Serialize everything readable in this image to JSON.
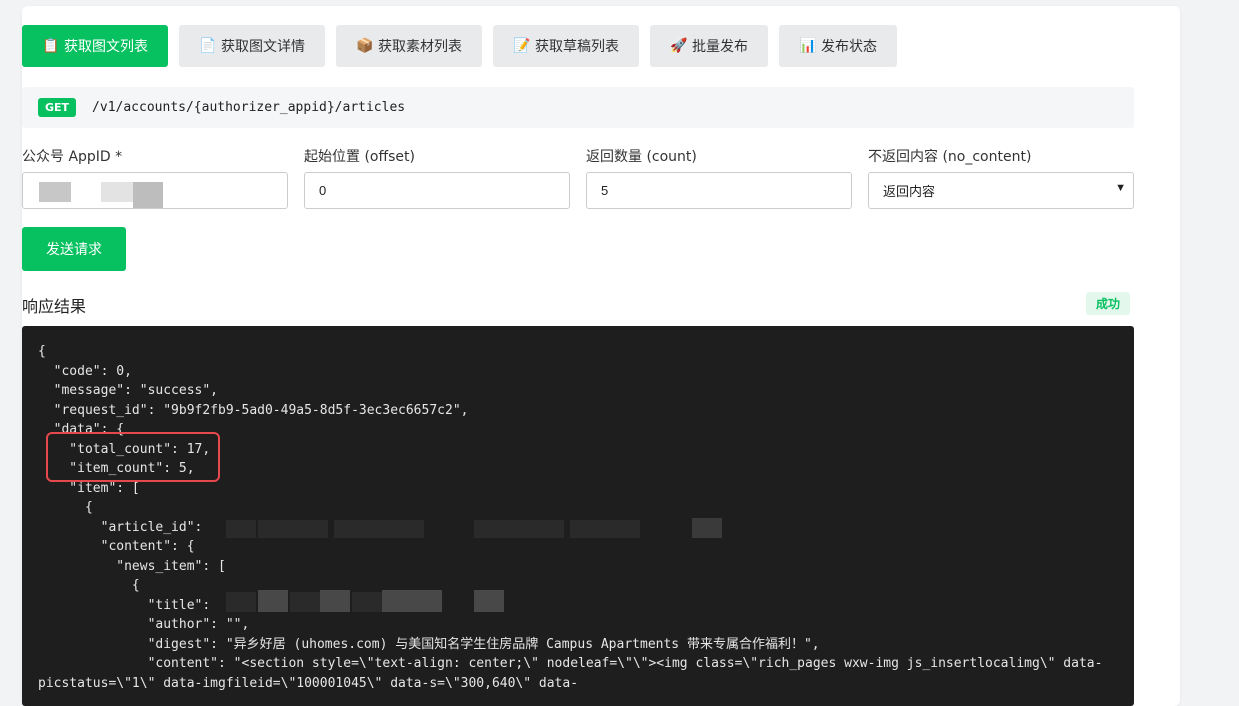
{
  "tabs": [
    {
      "icon": "📋",
      "label": "获取图文列表",
      "active": true
    },
    {
      "icon": "📄",
      "label": "获取图文详情",
      "active": false
    },
    {
      "icon": "📦",
      "label": "获取素材列表",
      "active": false
    },
    {
      "icon": "📝",
      "label": "获取草稿列表",
      "active": false
    },
    {
      "icon": "🚀",
      "label": "批量发布",
      "active": false
    },
    {
      "icon": "📊",
      "label": "发布状态",
      "active": false
    }
  ],
  "endpoint": {
    "method": "GET",
    "path": "/v1/accounts/{authorizer_appid}/articles"
  },
  "form": {
    "appid": {
      "label": "公众号 AppID *",
      "value": ""
    },
    "offset": {
      "label": "起始位置 (offset)",
      "value": "0"
    },
    "count": {
      "label": "返回数量 (count)",
      "value": "5"
    },
    "no_content": {
      "label": "不返回内容 (no_content)",
      "value": "返回内容"
    }
  },
  "send_label": "发送请求",
  "response": {
    "title": "响应结果",
    "status": "成功",
    "lines": [
      "{",
      "  \"code\": 0,",
      "  \"message\": \"success\",",
      "  \"request_id\": \"9b9f2fb9-5ad0-49a5-8d5f-3ec3ec6657c2\",",
      "  \"data\": {",
      "    \"total_count\": 17,",
      "    \"item_count\": 5,",
      "    \"item\": [",
      "      {",
      "        \"article_id\":",
      "        \"content\": {",
      "          \"news_item\": [",
      "            {",
      "              \"title\":",
      "              \"author\": \"\",",
      "              \"digest\": \"异乡好居 (uhomes.com) 与美国知名学生住房品牌 Campus Apartments 带来专属合作福利！\",",
      "              \"content\": \"<section style=\\\"text-align: center;\\\" nodeleaf=\\\"\\\"><img class=\\\"rich_pages wxw-img js_insertlocalimg\\\" data-",
      "picstatus=\\\"1\\\" data-imgfileid=\\\"100001045\\\" data-s=\\\"300,640\\\" data-"
    ]
  },
  "colors": {
    "accent": "#07c160",
    "highlight": "#e5484d"
  }
}
